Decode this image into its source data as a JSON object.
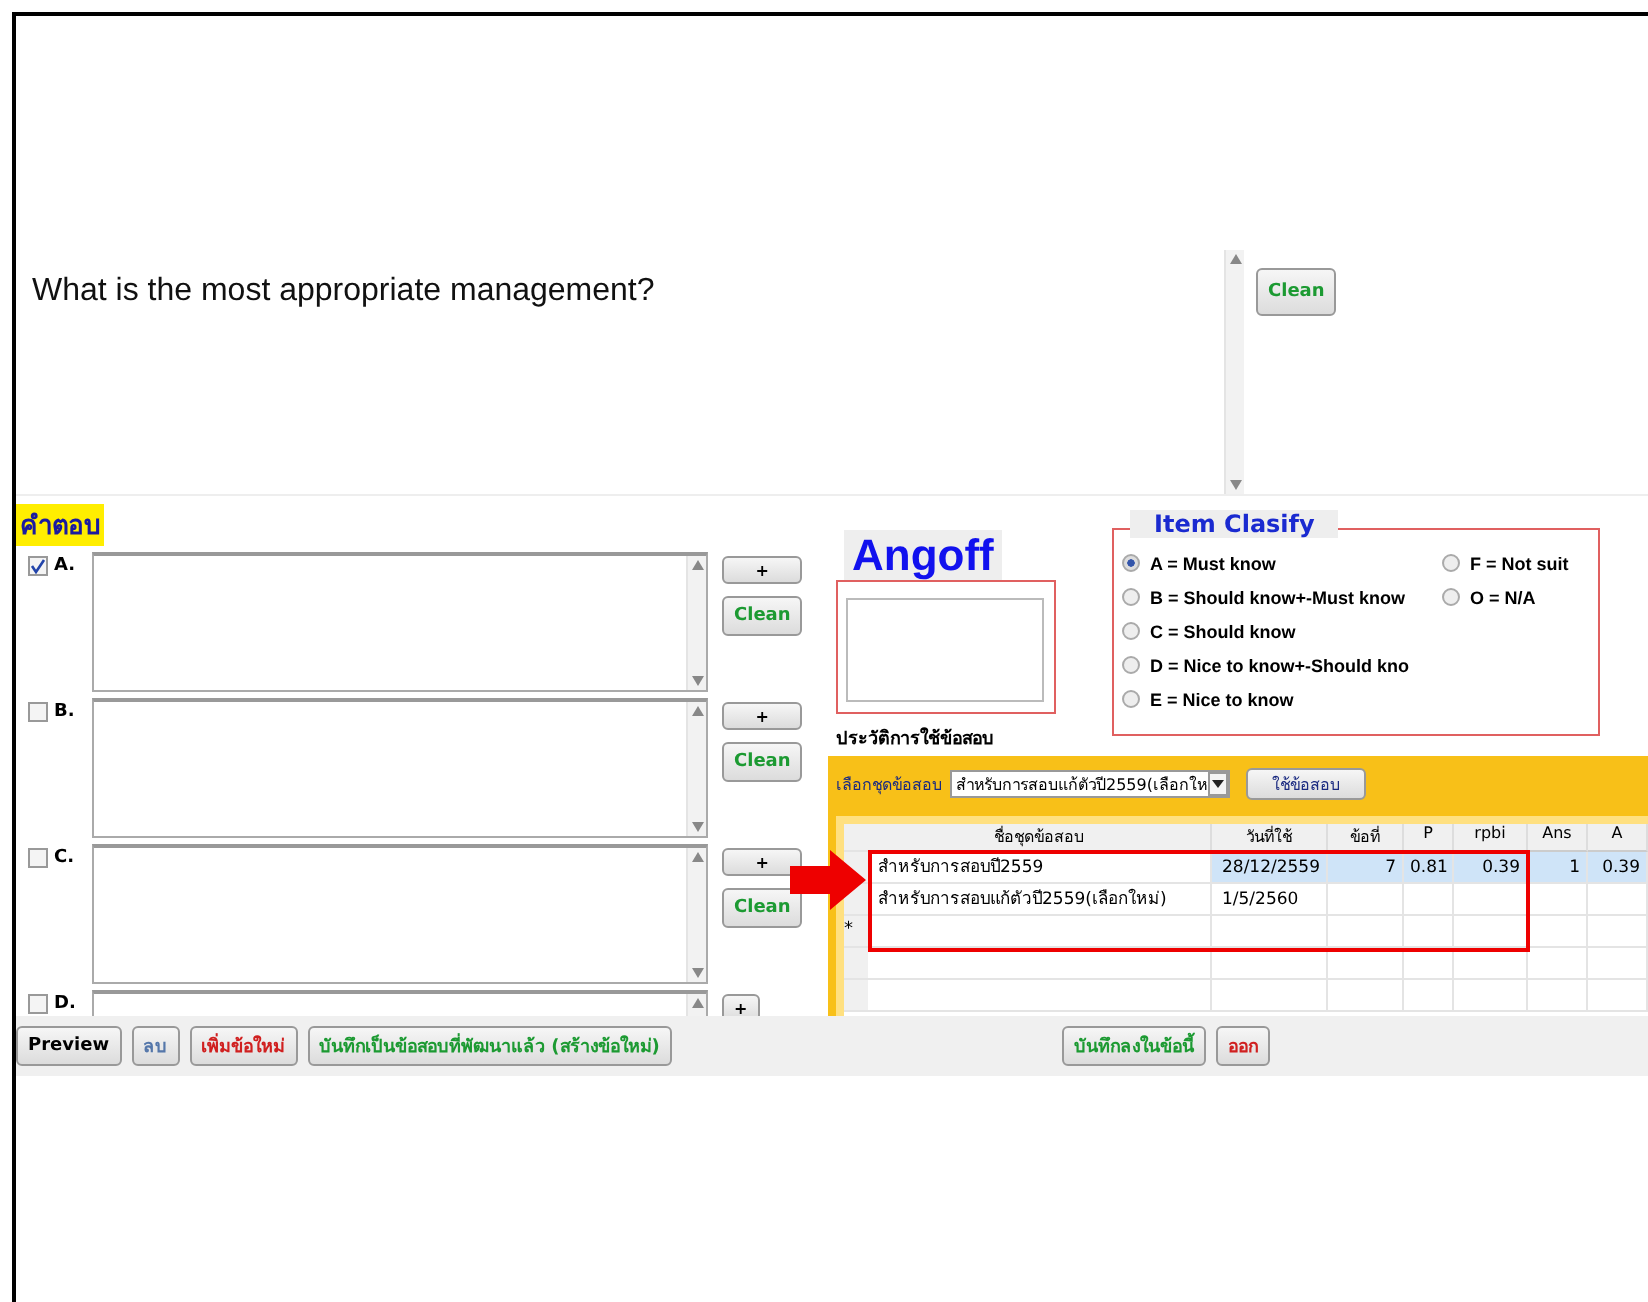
{
  "question": {
    "text": "What is the most appropriate management?",
    "clean_button": "Clean"
  },
  "answers": {
    "heading": "คำตอบ",
    "options": [
      {
        "label": "A.",
        "checked": true,
        "add_button": "+",
        "clean_button": "Clean"
      },
      {
        "label": "B.",
        "checked": false,
        "add_button": "+",
        "clean_button": "Clean"
      },
      {
        "label": "C.",
        "checked": false,
        "add_button": "+",
        "clean_button": "Clean"
      },
      {
        "label": "D.",
        "checked": false,
        "add_button": "+"
      }
    ]
  },
  "angoff": {
    "title": "Angoff"
  },
  "item_classify": {
    "title": "Item Clasify",
    "options": [
      {
        "label": "A = Must know",
        "selected": true
      },
      {
        "label": "B = Should know+-Must know",
        "selected": false
      },
      {
        "label": "C = Should know",
        "selected": false
      },
      {
        "label": "D = Nice to know+-Should kno",
        "selected": false
      },
      {
        "label": "E = Nice to know",
        "selected": false
      },
      {
        "label": "F = Not suit",
        "selected": false
      },
      {
        "label": "O = N/A",
        "selected": false
      }
    ]
  },
  "history": {
    "title": "ประวัติการใช้ข้อสอบ",
    "select_label": "เลือกชุดข้อสอบ",
    "select_value": "สำหรับการสอบแก้ตัวปี2559(เลือกให",
    "use_button": "ใช้ข้อสอบ",
    "columns": [
      "ชื่อชุดข้อสอบ",
      "วันที่ใช้",
      "ข้อที่",
      "P",
      "rpbi",
      "Ans",
      "A"
    ],
    "rows": [
      {
        "selected": true,
        "cells": [
          "สำหรับการสอบปี2559",
          "28/12/2559",
          "7",
          "0.81",
          "0.39",
          "1",
          "0.39"
        ]
      },
      {
        "selected": false,
        "cells": [
          "สำหรับการสอบแก้ตัวปี2559(เลือกใหม่)",
          "1/5/2560",
          "",
          "",
          "",
          "",
          ""
        ]
      }
    ],
    "new_row_marker": "*"
  },
  "toolbar": {
    "left": [
      {
        "label": "Preview",
        "kind": "plain"
      },
      {
        "label": "ลบ",
        "kind": "blue"
      },
      {
        "label": "เพิ่มข้อใหม่",
        "kind": "red"
      },
      {
        "label": "บันทึกเป็นข้อสอบที่พัฒนาแล้ว (สร้างข้อใหม่)",
        "kind": "green"
      }
    ],
    "right": [
      {
        "label": "บันทึกลงในข้อนี้",
        "kind": "green"
      },
      {
        "label": "ออก",
        "kind": "red"
      }
    ]
  }
}
